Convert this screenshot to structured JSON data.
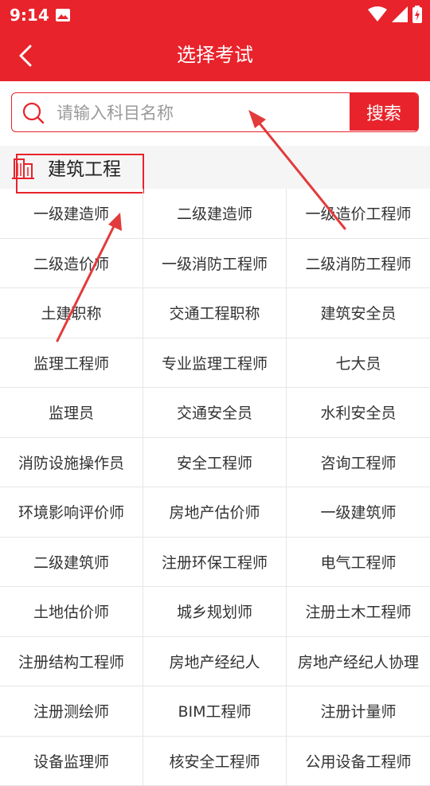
{
  "status_bar": {
    "time": "9:14"
  },
  "header": {
    "title": "选择考试"
  },
  "search": {
    "placeholder": "请输入科目名称",
    "button_label": "搜索"
  },
  "section": {
    "label": "建筑工程"
  },
  "exams": [
    "一级建造师",
    "二级建造师",
    "一级造价工程师",
    "二级造价师",
    "一级消防工程师",
    "二级消防工程师",
    "土建职称",
    "交通工程职称",
    "建筑安全员",
    "监理工程师",
    "专业监理工程师",
    "七大员",
    "监理员",
    "交通安全员",
    "水利安全员",
    "消防设施操作员",
    "安全工程师",
    "咨询工程师",
    "环境影响评价师",
    "房地产估价师",
    "一级建筑师",
    "二级建筑师",
    "注册环保工程师",
    "电气工程师",
    "土地估价师",
    "城乡规划师",
    "注册土木工程师",
    "注册结构工程师",
    "房地产经纪人",
    "房地产经纪人协理",
    "注册测绘师",
    "BIM工程师",
    "注册计量师",
    "设备监理师",
    "核安全工程师",
    "公用设备工程师"
  ],
  "colors": {
    "brand": "#e8232b",
    "annotation": "#e23b3b"
  }
}
